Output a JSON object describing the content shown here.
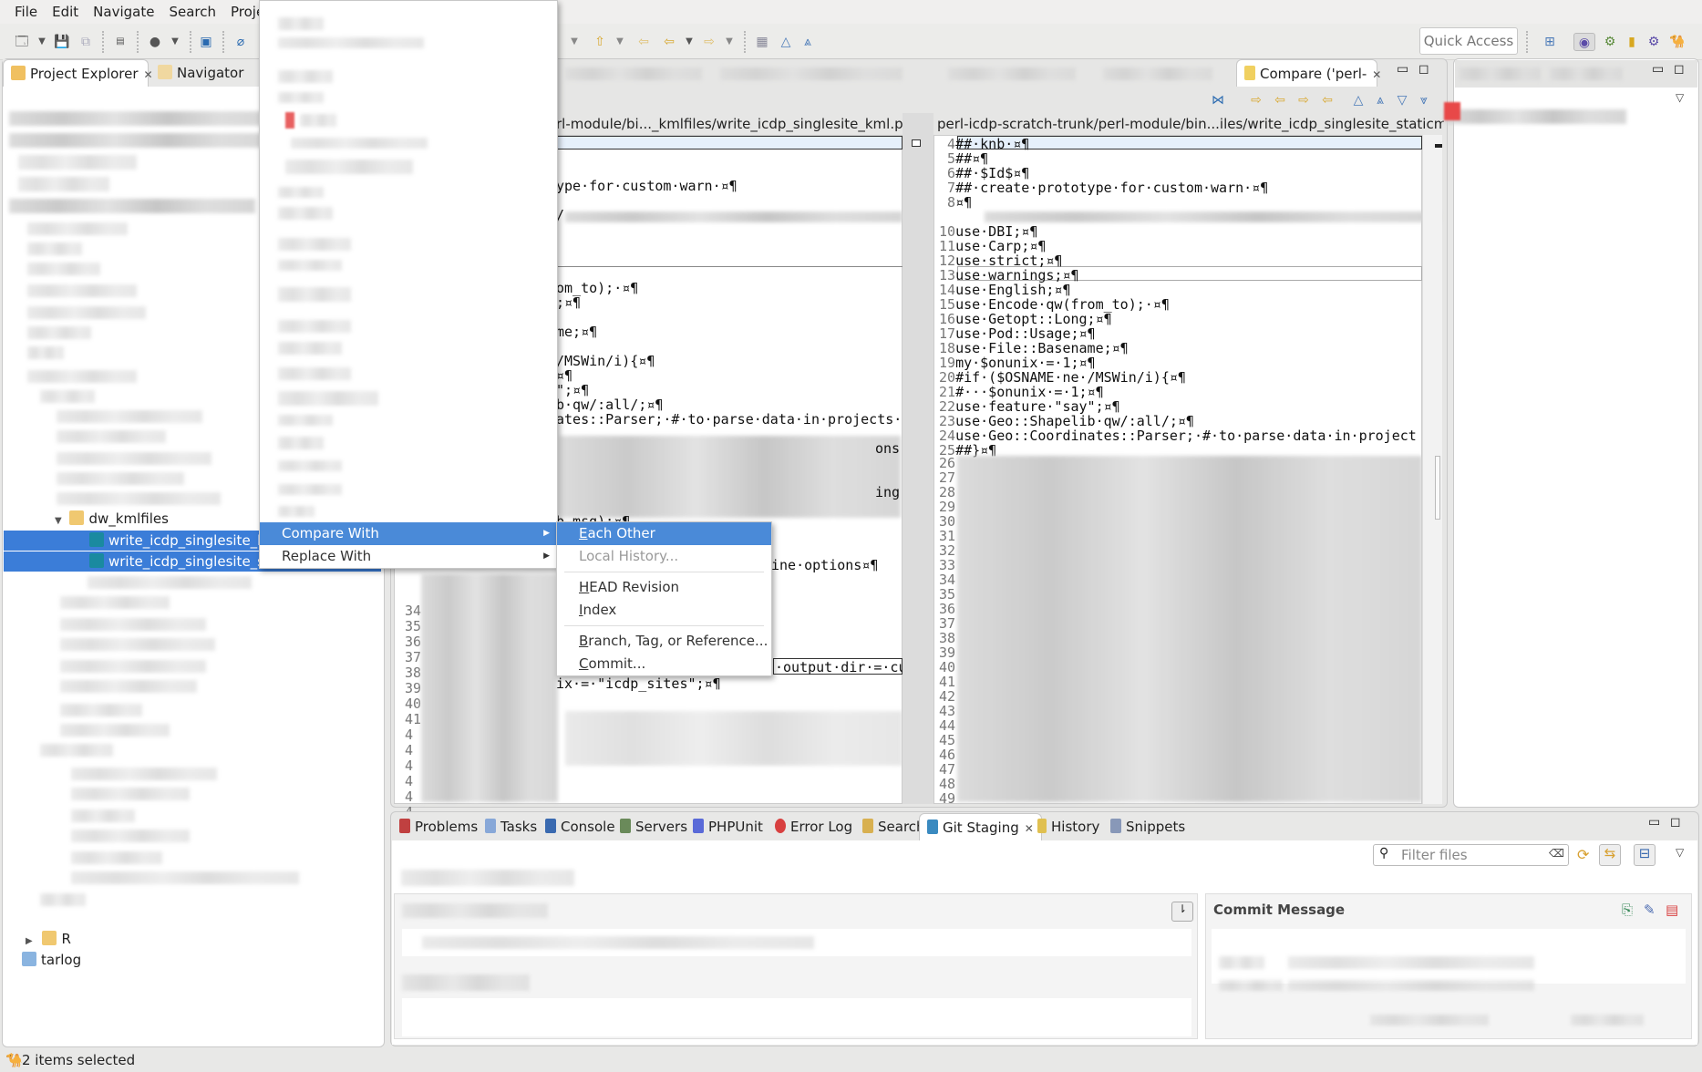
{
  "menubar": {
    "items": [
      "File",
      "Edit",
      "Navigate",
      "Search",
      "Project"
    ]
  },
  "toolbar": {
    "quick_access": "Quick Access"
  },
  "explorer": {
    "tabs": [
      {
        "label": "Project Explorer",
        "active": true,
        "close": "✕"
      },
      {
        "label": "Navigator",
        "active": false
      }
    ],
    "folder": "dw_kmlfiles",
    "selected_files": [
      "write_icdp_singlesite_kml.pl",
      "write_icdp_singlesite_staticmap.pl"
    ],
    "selected_visible": [
      "write_icdp_singlesite_kn",
      "write_icdp_singlesite_st"
    ],
    "folder_r": "R",
    "folder_tarlog": "tarlog"
  },
  "context_menu": {
    "compare_with": "Compare With",
    "replace_with": "Replace With",
    "submenu": {
      "each_other": "Each Other",
      "local_history": "Local History...",
      "head_revision": "HEAD Revision",
      "index": "Index",
      "branch_tag": "Branch, Tag, or Reference...",
      "commit": "Commit..."
    }
  },
  "compare": {
    "tab_label": "Compare ('perl-",
    "left_header": "perl-icdp-scratch-trunk/perl-module/bi..._kmlfiles/write_icdp_singlesite_kml.pl",
    "left_header_visible": "rl-module/bi..._kmlfiles/write_icdp_singlesite_kml.pl",
    "right_header": "perl-icdp-scratch-trunk/perl-module/bin...iles/write_icdp_singlesite_staticmap.pl",
    "left_fragments": [
      "ype·for·custom·warn·¤¶",
      "/",
      "om_to);·¤¶",
      ";¤¶",
      "me;¤¶",
      "/MSWin/i){¤¶",
      "¤¶",
      "\";¤¶",
      "b·qw/:all/;¤¶",
      "ates::Parser;·#·to·parse·data·in·projects·",
      "b_msg);¤¶",
      "ine·options¤¶",
      "·output·dir·=·cu",
      "ix·=·\"icdp_sites\";¤¶",
      "ing",
      "ons"
    ],
    "left_line_numbers": [
      "34",
      "35",
      "36",
      "37",
      "38",
      "39",
      "40",
      "41",
      "4",
      "4",
      "4",
      "4",
      "4",
      "4",
      "4"
    ],
    "right_lines": [
      {
        "n": "4",
        "t": "##·knb·¤¶"
      },
      {
        "n": "5",
        "t": "##¤¶"
      },
      {
        "n": "6",
        "t": "##·$Id$¤¶"
      },
      {
        "n": "7",
        "t": "##·create·prototype·for·custom·warn·¤¶"
      },
      {
        "n": "8",
        "t": "¤¶"
      },
      {
        "n": "10",
        "t": "use·DBI;¤¶"
      },
      {
        "n": "11",
        "t": "use·Carp;¤¶"
      },
      {
        "n": "12",
        "t": "use·strict;¤¶"
      },
      {
        "n": "13",
        "t": "use·warnings;¤¶"
      },
      {
        "n": "14",
        "t": "use·English;¤¶"
      },
      {
        "n": "15",
        "t": "use·Encode·qw(from_to);·¤¶"
      },
      {
        "n": "16",
        "t": "use·Getopt::Long;¤¶"
      },
      {
        "n": "17",
        "t": "use·Pod::Usage;¤¶"
      },
      {
        "n": "18",
        "t": "use·File::Basename;¤¶"
      },
      {
        "n": "19",
        "t": "my·$onunix·=·1;¤¶"
      },
      {
        "n": "20",
        "t": "#if·($OSNAME·ne·/MSWin/i){¤¶"
      },
      {
        "n": "21",
        "t": "#···$onunix·=·1;¤¶"
      },
      {
        "n": "22",
        "t": "use·feature·\"say\";¤¶"
      },
      {
        "n": "23",
        "t": "use·Geo::Shapelib·qw/:all/;¤¶"
      },
      {
        "n": "24",
        "t": "use·Geo::Coordinates::Parser;·#·to·parse·data·in·project"
      },
      {
        "n": "25",
        "t": "##}¤¶"
      }
    ],
    "right_blurred_numbers": [
      "26",
      "27",
      "28",
      "29",
      "30",
      "31",
      "32",
      "33",
      "34",
      "35",
      "36",
      "37",
      "38",
      "39",
      "40",
      "41",
      "42",
      "43",
      "44",
      "45",
      "46",
      "47",
      "48",
      "49"
    ]
  },
  "bottom_panel": {
    "tabs": [
      "Problems",
      "Tasks",
      "Console",
      "Servers",
      "PHPUnit",
      "Error Log",
      "Search",
      "Git Staging",
      "History",
      "Snippets"
    ],
    "active_tab": "Git Staging",
    "filter_placeholder": "Filter files",
    "commit_message_label": "Commit Message"
  },
  "status_bar": {
    "text": "2 items selected"
  },
  "colors": {
    "selection": "#3b7dd8",
    "menu_highlight": "#4a8ad8",
    "diff_highlight": "#e6f0fb"
  }
}
